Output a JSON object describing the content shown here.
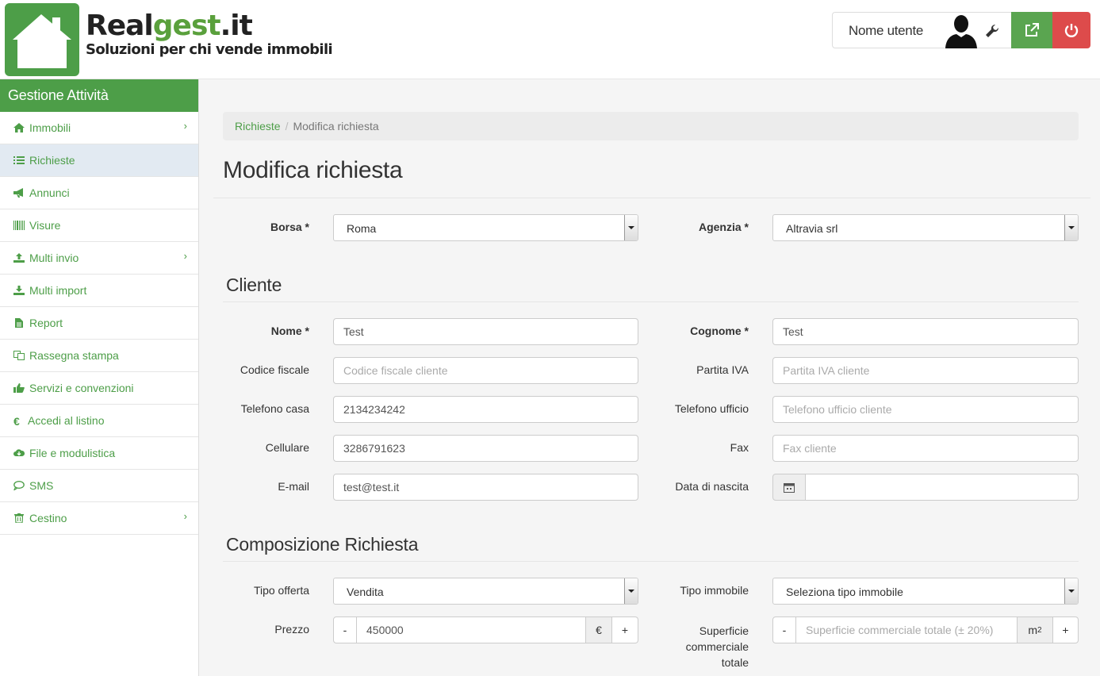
{
  "brand": {
    "name_part1": "Real",
    "name_part2": "gest",
    "name_part3": ".it",
    "tagline": "Soluzioni per chi vende immobili",
    "accent": "#5aa03c"
  },
  "user": {
    "name": "Nome utente"
  },
  "sidebar": {
    "title": "Gestione Attività",
    "items": [
      {
        "label": "Immobili",
        "icon": "home-icon",
        "chevron": "›"
      },
      {
        "label": "Richieste",
        "icon": "list-icon",
        "active": true
      },
      {
        "label": "Annunci",
        "icon": "bullhorn-icon"
      },
      {
        "label": "Visure",
        "icon": "barcode-icon"
      },
      {
        "label": "Multi invio",
        "icon": "upload-icon",
        "chevron": "›"
      },
      {
        "label": "Multi import",
        "icon": "download-icon"
      },
      {
        "label": "Report",
        "icon": "file-icon"
      },
      {
        "label": "Rassegna stampa",
        "icon": "copy-icon"
      },
      {
        "label": "Servizi e convenzioni",
        "icon": "thumbs-up-icon"
      },
      {
        "label": "Accedi al listino",
        "icon": "euro-icon",
        "glyph": "€"
      },
      {
        "label": "File e modulistica",
        "icon": "cloud-download-icon"
      },
      {
        "label": "SMS",
        "icon": "comment-icon"
      },
      {
        "label": "Cestino",
        "icon": "trash-icon",
        "chevron": "›"
      }
    ]
  },
  "breadcrumb": {
    "parent": "Richieste",
    "sep": "/",
    "current": "Modifica richiesta"
  },
  "page_title": "Modifica richiesta",
  "form": {
    "borsa": {
      "label": "Borsa *",
      "value": "Roma"
    },
    "agenzia": {
      "label": "Agenzia *",
      "value": "Altravia srl"
    },
    "cliente_title": "Cliente",
    "nome": {
      "label": "Nome *",
      "value": "Test"
    },
    "cognome": {
      "label": "Cognome *",
      "value": "Test"
    },
    "codice_fiscale": {
      "label": "Codice fiscale",
      "placeholder": "Codice fiscale cliente"
    },
    "partita_iva": {
      "label": "Partita IVA",
      "placeholder": "Partita IVA cliente"
    },
    "telefono_casa": {
      "label": "Telefono casa",
      "value": "2134234242"
    },
    "telefono_ufficio": {
      "label": "Telefono ufficio",
      "placeholder": "Telefono ufficio cliente"
    },
    "cellulare": {
      "label": "Cellulare",
      "value": "3286791623"
    },
    "fax": {
      "label": "Fax",
      "placeholder": "Fax cliente"
    },
    "email": {
      "label": "E-mail",
      "value": "test@test.it"
    },
    "data_nascita": {
      "label": "Data di nascita",
      "value": ""
    },
    "composizione_title": "Composizione Richiesta",
    "tipo_offerta": {
      "label": "Tipo offerta",
      "value": "Vendita"
    },
    "tipo_immobile": {
      "label": "Tipo immobile",
      "value": "Seleziona tipo immobile"
    },
    "prezzo": {
      "label": "Prezzo",
      "value": "450000",
      "minus": "-",
      "plus": "+",
      "unit": "€"
    },
    "superficie": {
      "label_l1": "Superficie",
      "label_l2": "commerciale",
      "label_l3": "totale",
      "placeholder": "Superficie commerciale totale (± 20%)",
      "minus": "-",
      "plus": "+",
      "unit": "m",
      "unit_sup": "2"
    }
  }
}
